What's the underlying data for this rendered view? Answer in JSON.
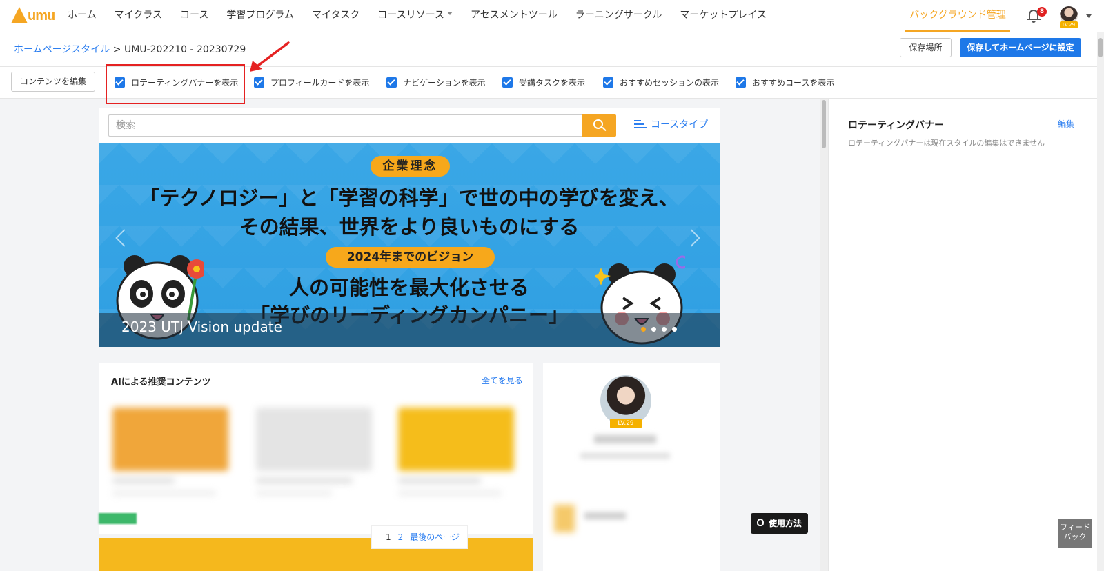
{
  "nav": {
    "logo_text": "umu",
    "items": [
      "ホーム",
      "マイクラス",
      "コース",
      "学習プログラム",
      "マイタスク",
      "コースリソース",
      "アセスメントツール",
      "ラーニングサークル",
      "マーケットプレイス"
    ],
    "background_manage": "バックグラウンド管理",
    "notification_count": "8",
    "user_level": "LV.29"
  },
  "breadcrumb": {
    "link": "ホームページスタイル",
    "separator": " > ",
    "current": "UMU-202210 - 20230729"
  },
  "actions": {
    "save_location": "保存場所",
    "save_and_set": "保存してホームページに設定"
  },
  "toggles": {
    "edit_content": "コンテンツを編集",
    "items": [
      {
        "label": "ロテーティングバナーを表示",
        "checked": true
      },
      {
        "label": "プロフィールカードを表示",
        "checked": true
      },
      {
        "label": "ナビゲーションを表示",
        "checked": true
      },
      {
        "label": "受講タスクを表示",
        "checked": true
      },
      {
        "label": "おすすめセッションの表示",
        "checked": true
      },
      {
        "label": "おすすめコースを表示",
        "checked": true
      }
    ]
  },
  "search": {
    "placeholder": "検索",
    "course_type": "コースタイプ"
  },
  "banner": {
    "pill_top": "企業理念",
    "line1": "「テクノロジー」と「学習の科学」で世の中の学びを変え、",
    "line2": "その結果、世界をより良いものにする",
    "pill_mid": "2024年までのビジョン",
    "line3": "人の可能性を最大化させる",
    "line4": "「学びのリーディングカンパニー」",
    "caption": "2023 UTJ Vision update"
  },
  "ai_section": {
    "title": "AIによる推奨コンテンツ",
    "see_all": "全てを見る"
  },
  "pager": {
    "pages": [
      "1",
      "2"
    ],
    "last": "最後のページ"
  },
  "profile": {
    "level": "LV.29"
  },
  "right_panel": {
    "title": "ロテーティングバナー",
    "edit": "編集",
    "description": "ロテーティングバナーは現在スタイルの編集はできません"
  },
  "floating": {
    "how_to": "使用方法",
    "feedback": "フィードバック"
  },
  "colors": {
    "accent_orange": "#f5a623",
    "primary_blue": "#1e78e8",
    "link_blue": "#2d7ff0",
    "highlight_red": "#e52222",
    "banner_blue": "#3aa7e6"
  }
}
